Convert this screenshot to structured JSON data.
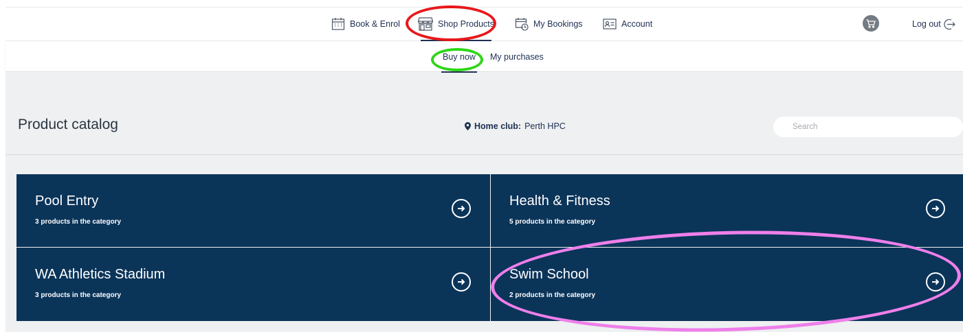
{
  "nav": {
    "items": [
      {
        "label": "Book & Enrol",
        "icon": "calendar-icon"
      },
      {
        "label": "Shop Products",
        "icon": "storefront-icon",
        "active": true
      },
      {
        "label": "My Bookings",
        "icon": "calendar-clock-icon"
      },
      {
        "label": "Account",
        "icon": "id-card-icon"
      }
    ],
    "cart_icon": "cart-icon",
    "logout_label": "Log out"
  },
  "subnav": {
    "items": [
      {
        "label": "Buy now",
        "active": true
      },
      {
        "label": "My purchases"
      }
    ]
  },
  "catalog": {
    "title": "Product catalog",
    "home_club_label": "Home club:",
    "home_club_value": "Perth HPC",
    "search_placeholder": "Search",
    "categories": [
      {
        "name": "Pool Entry",
        "count": "3 products in the category"
      },
      {
        "name": "Health & Fitness",
        "count": "5 products in the category"
      },
      {
        "name": "WA Athletics Stadium",
        "count": "3 products in the category"
      },
      {
        "name": "Swim School",
        "count": "2 products in the category"
      }
    ]
  },
  "colors": {
    "tile_bg": "#0b3459",
    "annotation_red": "#e8171b",
    "annotation_green": "#2dd617",
    "annotation_pink": "#ee7fea"
  }
}
